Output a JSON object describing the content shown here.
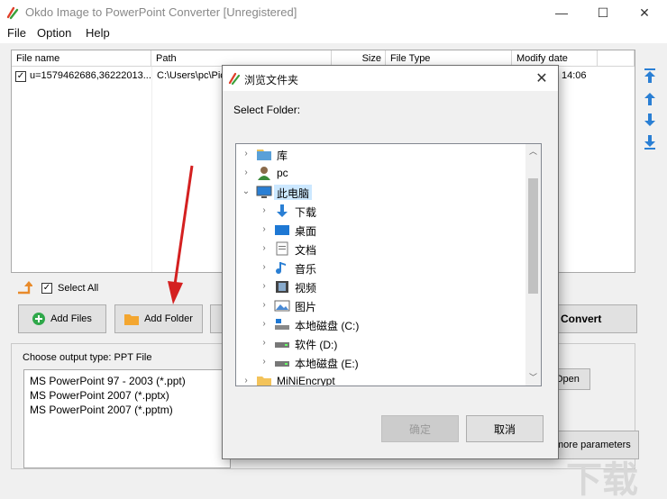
{
  "app": {
    "title": "Okdo Image to PowerPoint Converter [Unregistered]"
  },
  "window_controls": {
    "minimize": "—",
    "maximize": "☐",
    "close": "✕"
  },
  "menu": [
    "File",
    "Option",
    "Help"
  ],
  "file_table": {
    "columns": [
      "File name",
      "Path",
      "Size",
      "File Type",
      "Modify date"
    ],
    "rows": [
      {
        "checked": true,
        "name": "u=1579462686,36222013...",
        "path": "C:\\Users\\pc\\Pic",
        "modify_date": "14:06"
      }
    ]
  },
  "side_arrows": [
    "move-top-icon",
    "move-up-icon",
    "move-down-icon",
    "move-bottom-icon"
  ],
  "select_all": {
    "label": "Select All",
    "checked": true
  },
  "buttons": {
    "add_files": "Add Files",
    "add_folder": "Add Folder",
    "convert": "Convert",
    "open": "Open",
    "more_parameters": "more parameters"
  },
  "output": {
    "label": "Choose output type:  PPT File",
    "types": [
      "MS PowerPoint 97 - 2003 (*.ppt)",
      "MS PowerPoint 2007 (*.pptx)",
      "MS PowerPoint 2007 (*.pptm)"
    ]
  },
  "dialog": {
    "title": "浏览文件夹",
    "label": "Select Folder:",
    "tree": [
      {
        "label": "库",
        "icon": "library-icon",
        "level": 0,
        "caret": "›"
      },
      {
        "label": "pc",
        "icon": "user-icon",
        "level": 0,
        "caret": "›"
      },
      {
        "label": "此电脑",
        "icon": "computer-icon",
        "level": 0,
        "caret": "⌄",
        "selected": true
      },
      {
        "label": "下载",
        "icon": "download-icon",
        "level": 1,
        "caret": "›"
      },
      {
        "label": "桌面",
        "icon": "desktop-icon",
        "level": 1,
        "caret": "›"
      },
      {
        "label": "文档",
        "icon": "document-icon",
        "level": 1,
        "caret": "›"
      },
      {
        "label": "音乐",
        "icon": "music-icon",
        "level": 1,
        "caret": "›"
      },
      {
        "label": "视频",
        "icon": "video-icon",
        "level": 1,
        "caret": "›"
      },
      {
        "label": "图片",
        "icon": "picture-icon",
        "level": 1,
        "caret": "›"
      },
      {
        "label": "本地磁盘 (C:)",
        "icon": "drive-c-icon",
        "level": 1,
        "caret": "›"
      },
      {
        "label": "软件 (D:)",
        "icon": "drive-icon",
        "level": 1,
        "caret": "›"
      },
      {
        "label": "本地磁盘 (E:)",
        "icon": "drive-icon",
        "level": 1,
        "caret": "›"
      },
      {
        "label": "MiNiEncrypt",
        "icon": "folder-icon",
        "level": 0,
        "caret": "›"
      }
    ],
    "ok": "确定",
    "cancel": "取消"
  },
  "watermark": "下载"
}
